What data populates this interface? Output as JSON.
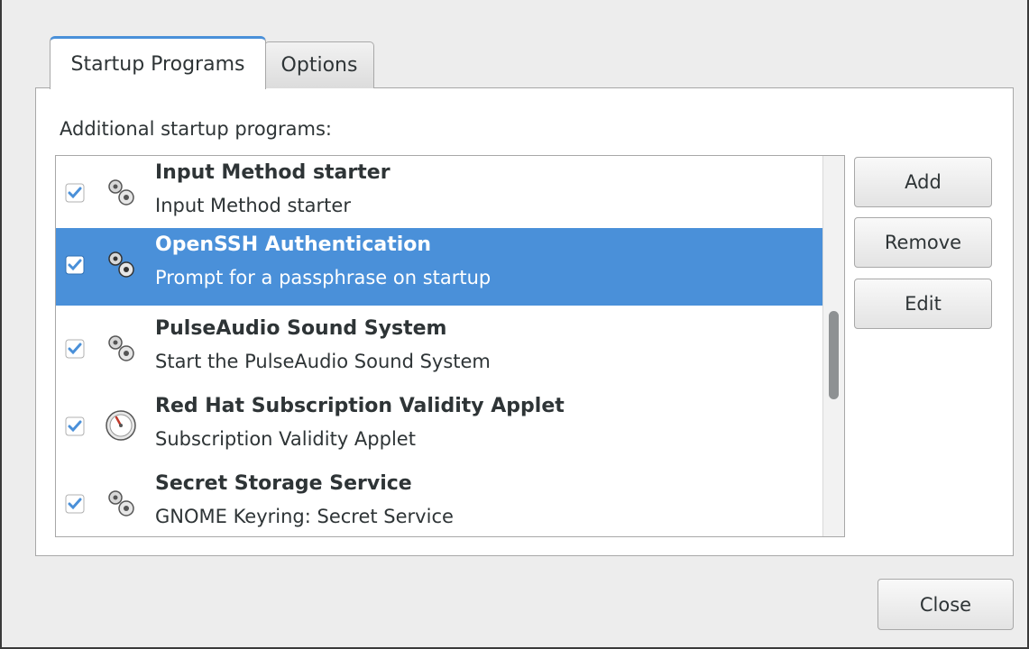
{
  "tabs": [
    {
      "label": "Startup Programs",
      "active": true
    },
    {
      "label": "Options",
      "active": false
    }
  ],
  "section_label": "Additional startup programs:",
  "programs": [
    {
      "title": "Input Method starter",
      "description": "Input Method starter",
      "enabled": true,
      "icon": "gears-icon",
      "selected": false
    },
    {
      "title": "OpenSSH Authentication",
      "description": "Prompt for a passphrase on startup",
      "enabled": true,
      "icon": "gears-icon",
      "selected": true
    },
    {
      "title": "PulseAudio Sound System",
      "description": "Start the PulseAudio Sound System",
      "enabled": true,
      "icon": "gears-icon",
      "selected": false
    },
    {
      "title": "Red Hat Subscription Validity Applet",
      "description": "Subscription Validity Applet",
      "enabled": true,
      "icon": "gauge-icon",
      "selected": false
    },
    {
      "title": "Secret Storage Service",
      "description": "GNOME Keyring: Secret Service",
      "enabled": true,
      "icon": "gears-icon",
      "selected": false
    }
  ],
  "buttons": {
    "add": "Add",
    "remove": "Remove",
    "edit": "Edit",
    "close": "Close"
  },
  "colors": {
    "selection": "#4a90d9",
    "check": "#4a90d9"
  }
}
